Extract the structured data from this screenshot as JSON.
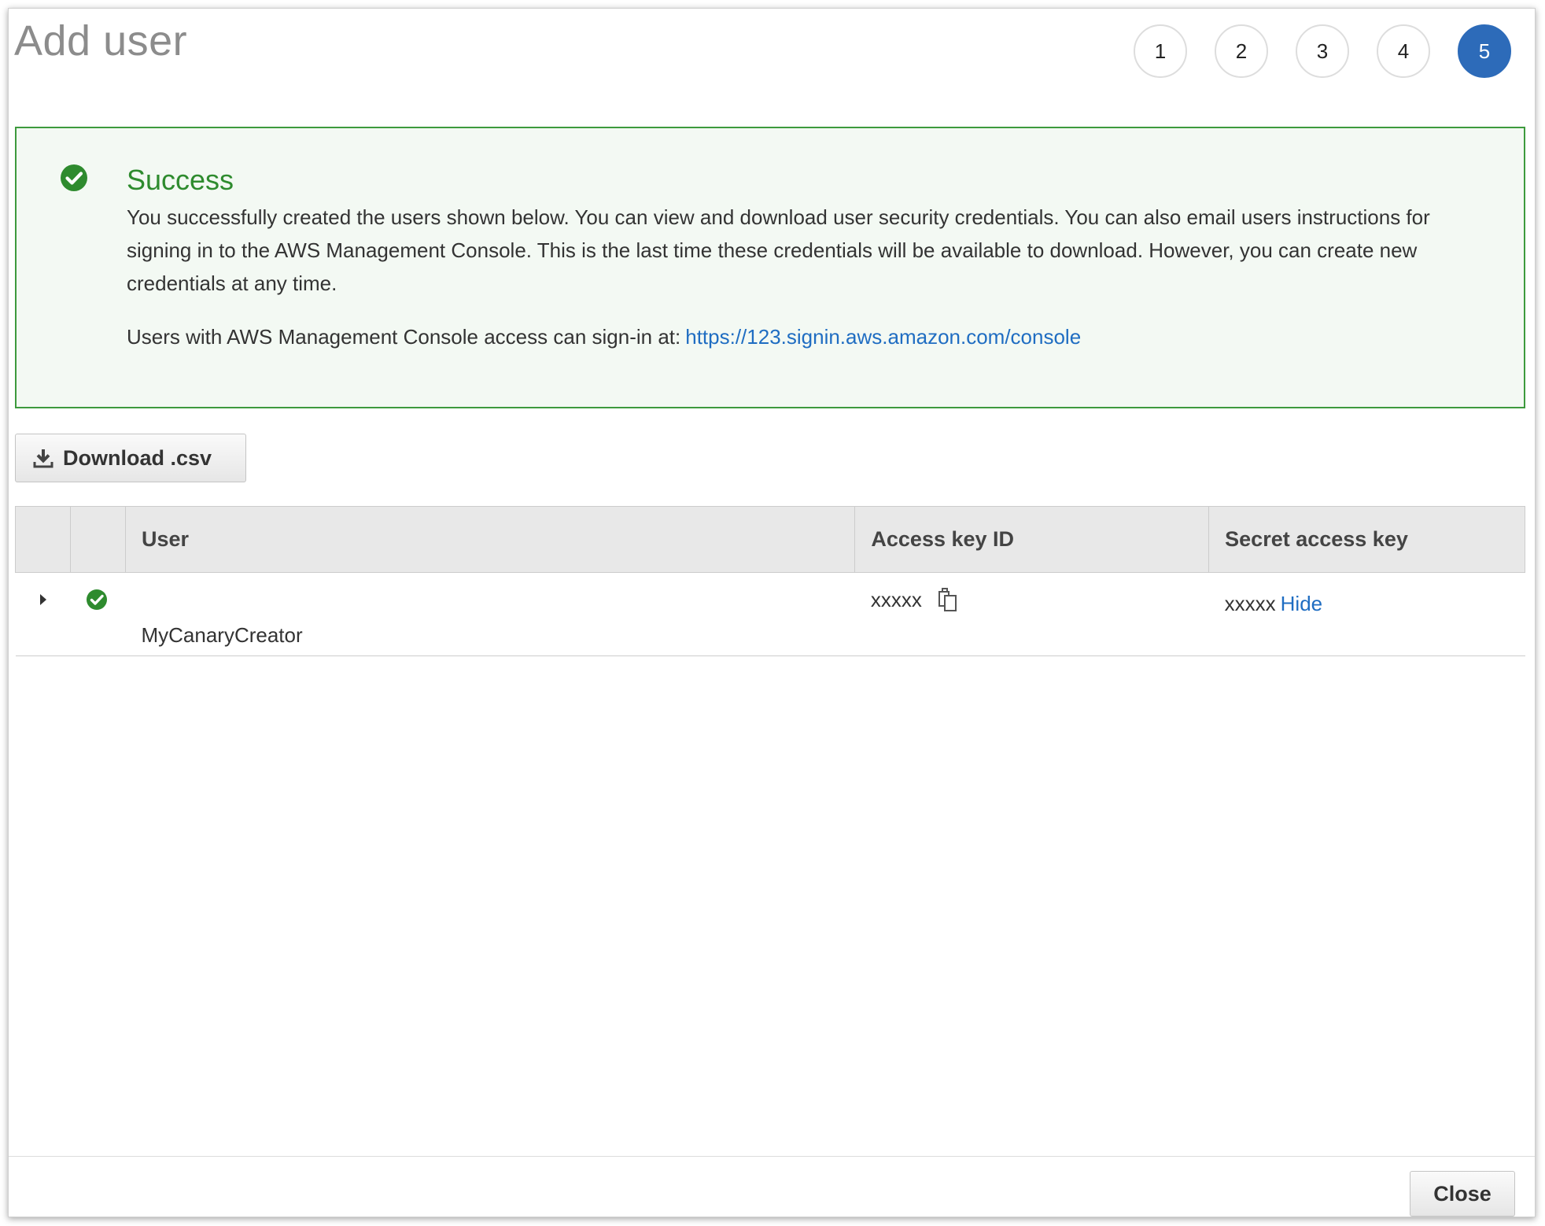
{
  "header": {
    "title": "Add user"
  },
  "steps": [
    "1",
    "2",
    "3",
    "4",
    "5"
  ],
  "active_step": "5",
  "alert": {
    "icon": "check-circle-icon",
    "title": "Success",
    "body": "You successfully created the users shown below. You can view and download user security credentials. You can also email users instructions for signing in to the AWS Management Console. This is the last time these credentials will be available to download. However, you can create new credentials at any time.",
    "signin_prefix": "Users with AWS Management Console access can sign-in at:",
    "signin_url": "https://123.signin.aws.amazon.com/console",
    "color": "#3d9a3d"
  },
  "download": {
    "label": "Download .csv",
    "icon": "download-icon"
  },
  "table": {
    "columns": [
      "User",
      "Access key ID",
      "Secret access key"
    ],
    "rows": [
      {
        "user": "MyCanaryCreator",
        "access_key_id": "xxxxx",
        "secret_access_key": "xxxxx",
        "hide_label": "Hide"
      }
    ]
  },
  "footer": {
    "close_label": "Close"
  },
  "colors": {
    "accent": "#2d6bb9",
    "link": "#1f6dc2",
    "success": "#2e8b2e"
  }
}
